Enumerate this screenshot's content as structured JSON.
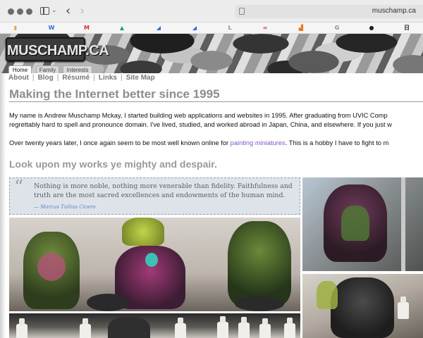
{
  "browser": {
    "url": "muschamp.ca",
    "favorites": [
      {
        "icon": "bar-chart-favicon",
        "glyph": "▮",
        "color": "#e8a23b"
      },
      {
        "icon": "wordpress-favicon",
        "glyph": "W",
        "color": "#2f6fd1"
      },
      {
        "icon": "gmail-favicon",
        "glyph": "M",
        "color": "#d93025"
      },
      {
        "icon": "google-drive-favicon",
        "glyph": "▲",
        "color": "#1fa463"
      },
      {
        "icon": "blue-chart-favicon",
        "glyph": "◢",
        "color": "#2b6fd6"
      },
      {
        "icon": "blue-chart-favicon-2",
        "glyph": "◢",
        "color": "#2b6fd6"
      },
      {
        "icon": "letter-l-favicon",
        "glyph": "L",
        "color": "#8a8f99"
      },
      {
        "icon": "link-favicon",
        "glyph": "∞",
        "color": "#e0452c"
      },
      {
        "icon": "orange-chart-favicon",
        "glyph": "▟",
        "color": "#e57c22"
      },
      {
        "icon": "letter-g-favicon",
        "glyph": "G",
        "color": "#8a8f99"
      },
      {
        "icon": "apple-favicon",
        "glyph": "●",
        "color": "#222222"
      },
      {
        "icon": "kanji-favicon",
        "glyph": "日",
        "color": "#222222"
      }
    ]
  },
  "site": {
    "logo": "MUSCHAMP.CA",
    "tabs": [
      {
        "label": "Home",
        "active": true
      },
      {
        "label": "Family",
        "active": false
      },
      {
        "label": "Interests",
        "active": false
      }
    ],
    "subnav": [
      "About",
      "Blog",
      "Résumé",
      "Links",
      "Site Map"
    ]
  },
  "content": {
    "heading": "Making the Internet better since 1995",
    "para1_line1": "My name is Andrew Muschamp Mckay, I started building web applications and websites in 1995. After graduating from UVIC Comp",
    "para1_line2": "regrettably hard to spell and pronounce domain. I've lived, studied, and worked abroad in Japan, China, and elsewhere. If you just w",
    "para2_before": "Over twenty years later, I once again seem to be most well known online for ",
    "para2_link": "painting miniatures",
    "para2_after": ". This is a hobby I have to fight to m",
    "subheading": "Look upon my works ye mighty and despair.",
    "quote": {
      "text": "Nothing is more noble, nothing more venerable than fidelity. Faithfulness and truth are the most sacred excellences and endowments of the human mind.",
      "cite": "— Marcus Tullius Cicero"
    }
  },
  "colors": {
    "link": "#7f55c9",
    "heading": "#8d8d8d",
    "quote_bg": "#dee3ea"
  }
}
